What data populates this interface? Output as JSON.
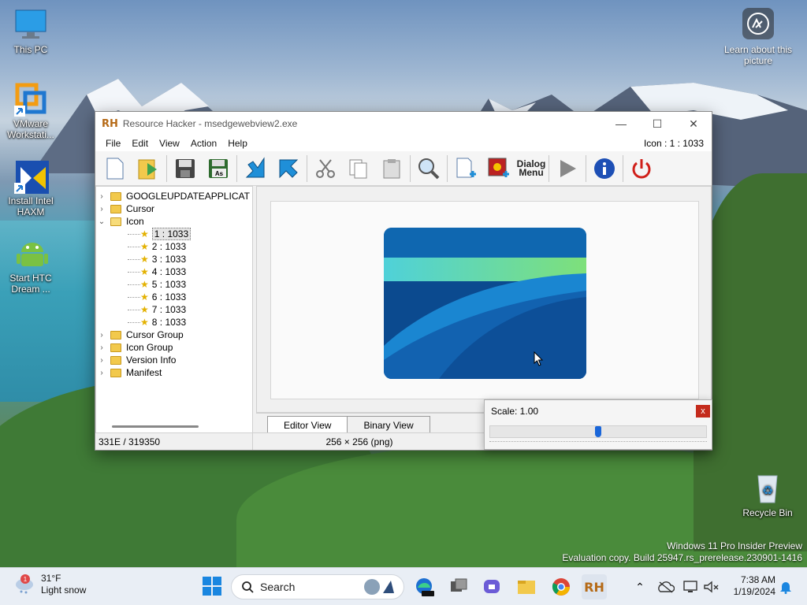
{
  "desktop": {
    "icons": [
      {
        "label": "This PC"
      },
      {
        "label": "VMware Workstati..."
      },
      {
        "label": "Install Intel HAXM"
      },
      {
        "label": "Start HTC Dream ..."
      },
      {
        "label": "Recycle Bin"
      }
    ],
    "learn_label": "Learn about this picture",
    "watermark_line1": "Windows 11 Pro Insider Preview",
    "watermark_line2": "Evaluation copy. Build 25947.rs_prerelease.230901-1416"
  },
  "window": {
    "app_logo": "RH",
    "title": "Resource Hacker - msedgewebview2.exe",
    "menu": [
      "File",
      "Edit",
      "View",
      "Action",
      "Help"
    ],
    "current_resource": "Icon : 1 : 1033",
    "toolbar_dialog_line1": "Dialog",
    "toolbar_dialog_line2": "Menu",
    "tree": {
      "top_items": [
        "GOOGLEUPDATEAPPLICAT",
        "Cursor"
      ],
      "icon_folder": "Icon",
      "icon_children": [
        "1 : 1033",
        "2 : 1033",
        "3 : 1033",
        "4 : 1033",
        "5 : 1033",
        "6 : 1033",
        "7 : 1033",
        "8 : 1033"
      ],
      "bottom_items": [
        "Cursor Group",
        "Icon Group",
        "Version Info",
        "Manifest"
      ]
    },
    "tabs": {
      "editor": "Editor View",
      "binary": "Binary View"
    },
    "status": {
      "offset": "331E / 319350",
      "dimensions": "256 × 256 (png)"
    }
  },
  "scale_popup": {
    "label": "Scale: 1.00",
    "close": "x",
    "slider_value": 0.5
  },
  "taskbar": {
    "weather_temp": "31°F",
    "weather_desc": "Light snow",
    "weather_badge": "1",
    "search_label": "Search",
    "time": "7:38 AM",
    "date": "1/19/2024"
  },
  "colors": {
    "accent": "#1a66d9",
    "close_red": "#c42b1c",
    "art_dark": "#0b4a8f",
    "art_teal": "#4fd1d9",
    "art_green": "#7ee07a"
  }
}
